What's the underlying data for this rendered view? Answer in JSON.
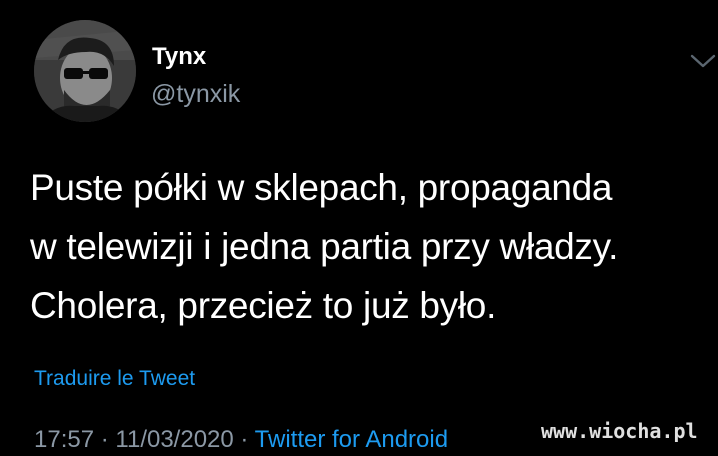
{
  "author": {
    "name": "Tynx",
    "handle": "@tynxik",
    "avatar": "avatar-photo"
  },
  "tweet": {
    "lines": [
      "Puste półki w sklepach, propaganda",
      "w telewizji i jedna partia przy władzy.",
      "Cholera, przecież to już było."
    ],
    "translate_label": "Traduire le Tweet"
  },
  "meta": {
    "time": "17:57",
    "separator": "·",
    "date": "11/03/2020",
    "source": "Twitter for Android"
  },
  "watermark": {
    "text": "www.wiocha.pl"
  },
  "colors": {
    "background": "#000000",
    "text": "#ffffff",
    "secondary": "#8b98a5",
    "link": "#1d9bf0"
  },
  "icons": {
    "menu": "chevron-down-icon"
  }
}
